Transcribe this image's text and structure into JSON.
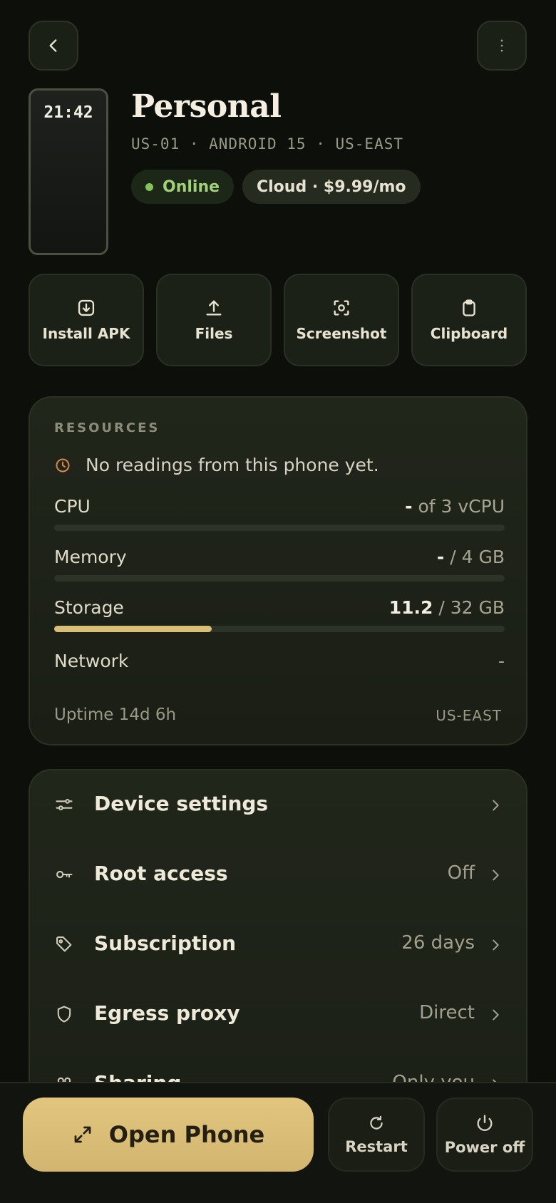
{
  "device": {
    "screen_time": "21:42",
    "name": "Personal",
    "subtitle": "US-01 · ANDROID 15 · US-EAST",
    "status": "Online",
    "plan": "Cloud · $9.99/mo"
  },
  "actions": [
    {
      "label": "Install APK",
      "icon": "install-apk-icon"
    },
    {
      "label": "Files",
      "icon": "upload-icon"
    },
    {
      "label": "Screenshot",
      "icon": "screenshot-icon"
    },
    {
      "label": "Clipboard",
      "icon": "clipboard-icon"
    }
  ],
  "resources": {
    "section_label": "RESOURCES",
    "notice": "No readings from this phone yet.",
    "cpu": {
      "label": "CPU",
      "current": "-",
      "rest": " of 3 vCPU",
      "fraction": 0
    },
    "memory": {
      "label": "Memory",
      "current": "-",
      "rest": " / 4 GB",
      "fraction": 0
    },
    "storage": {
      "label": "Storage",
      "current": "11.2",
      "rest": " / 32 GB",
      "fraction": 0.35
    },
    "network": {
      "label": "Network",
      "value": "-"
    },
    "uptime": "Uptime 14d 6h",
    "region": "US-EAST"
  },
  "settings": [
    {
      "label": "Device settings",
      "value": "",
      "icon": "sliders-icon"
    },
    {
      "label": "Root access",
      "value": "Off",
      "icon": "key-icon"
    },
    {
      "label": "Subscription",
      "value": "26 days",
      "icon": "tag-icon"
    },
    {
      "label": "Egress proxy",
      "value": "Direct",
      "icon": "shield-icon"
    },
    {
      "label": "Sharing",
      "value": "Only you",
      "icon": "people-icon"
    }
  ],
  "bottom": {
    "open_phone": "Open Phone",
    "restart": "Restart",
    "power_off": "Power off"
  },
  "colors": {
    "accent": "#d7be79",
    "online": "#86c45b",
    "clock_icon": "#d6894a"
  }
}
